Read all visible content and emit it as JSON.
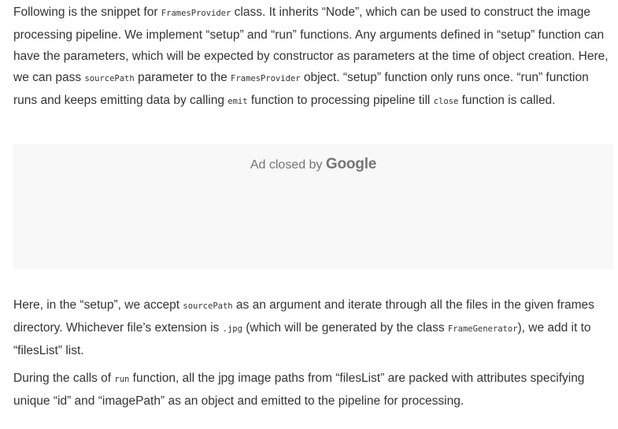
{
  "paragraph_1": {
    "t1": "Following is the snippet for ",
    "c1": "FramesProvider",
    "t2": " class. It inherits “Node”, which can be used to construct the image processing pipeline. We implement “setup” and “run” functions. Any arguments defined in “setup” function can have the parameters, which will be expected by constructor as parameters at the time of object creation. Here, we can pass ",
    "c2": "sourcePath",
    "t3": " parameter to the ",
    "c3": "FramesProvider",
    "t4": " object. “setup” function only runs once. “run” function runs and keeps emitting data by calling ",
    "c4": "emit",
    "t5": " function to processing pipeline till ",
    "c5": "close",
    "t6": " function is called."
  },
  "ad": {
    "text": "Ad closed by ",
    "brand": "Google"
  },
  "paragraph_2": {
    "t1": "Here, in the “setup”, we accept ",
    "c1": "sourcePath",
    "t2": " as an argument and iterate through all the files in the given frames directory. Whichever file’s extension is ",
    "c2": ".jpg",
    "t3": " (which will be generated by the class ",
    "c3": "FrameGenerator",
    "t4": "), we add it to “filesList” list."
  },
  "paragraph_3": {
    "t1": "During the calls of ",
    "c1": "run",
    "t2": " function, all the jpg image paths from “filesList” are packed with attributes specifying unique “id” and “imagePath” as an object and emitted to the pipeline for processing."
  }
}
